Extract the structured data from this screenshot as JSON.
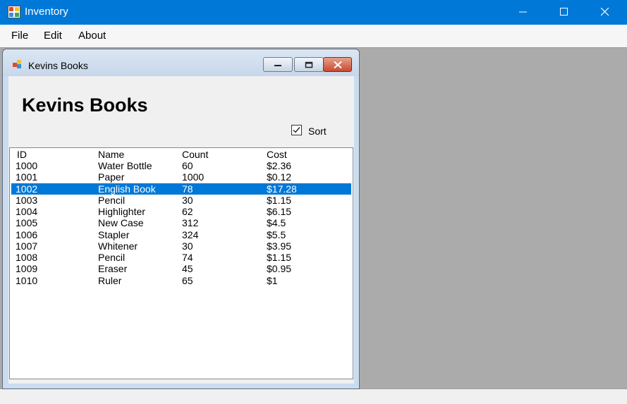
{
  "window": {
    "title": "Inventory"
  },
  "menu": [
    "File",
    "Edit",
    "About"
  ],
  "child": {
    "title": "Kevins Books",
    "heading": "Kevins Books",
    "sort": {
      "label": "Sort",
      "checked": true
    }
  },
  "list": {
    "columns": [
      "ID",
      "Name",
      "Count",
      "Cost"
    ],
    "selected_index": 2,
    "rows": [
      {
        "id": "1000",
        "name": "Water Bottle",
        "count": "60",
        "cost": "$2.36"
      },
      {
        "id": "1001",
        "name": "Paper",
        "count": "1000",
        "cost": "$0.12"
      },
      {
        "id": "1002",
        "name": "English Book",
        "count": "78",
        "cost": "$17.28"
      },
      {
        "id": "1003",
        "name": "Pencil",
        "count": "30",
        "cost": "$1.15"
      },
      {
        "id": "1004",
        "name": "Highlighter",
        "count": "62",
        "cost": "$6.15"
      },
      {
        "id": "1005",
        "name": "New Case",
        "count": "312",
        "cost": "$4.5"
      },
      {
        "id": "1006",
        "name": "Stapler",
        "count": "324",
        "cost": "$5.5"
      },
      {
        "id": "1007",
        "name": "Whitener",
        "count": "30",
        "cost": "$3.95"
      },
      {
        "id": "1008",
        "name": "Pencil",
        "count": "74",
        "cost": "$1.15"
      },
      {
        "id": "1009",
        "name": "Eraser",
        "count": "45",
        "cost": "$0.95"
      },
      {
        "id": "1010",
        "name": "Ruler",
        "count": "65",
        "cost": "$1"
      }
    ]
  },
  "colors": {
    "accent": "#0078d7",
    "selection": "#0078d7",
    "mdi_background": "#ababab"
  },
  "icons": {
    "app": "app-icon",
    "minimize": "minimize-icon",
    "maximize": "maximize-icon",
    "close": "close-icon",
    "checkmark": "checkmark-icon"
  }
}
